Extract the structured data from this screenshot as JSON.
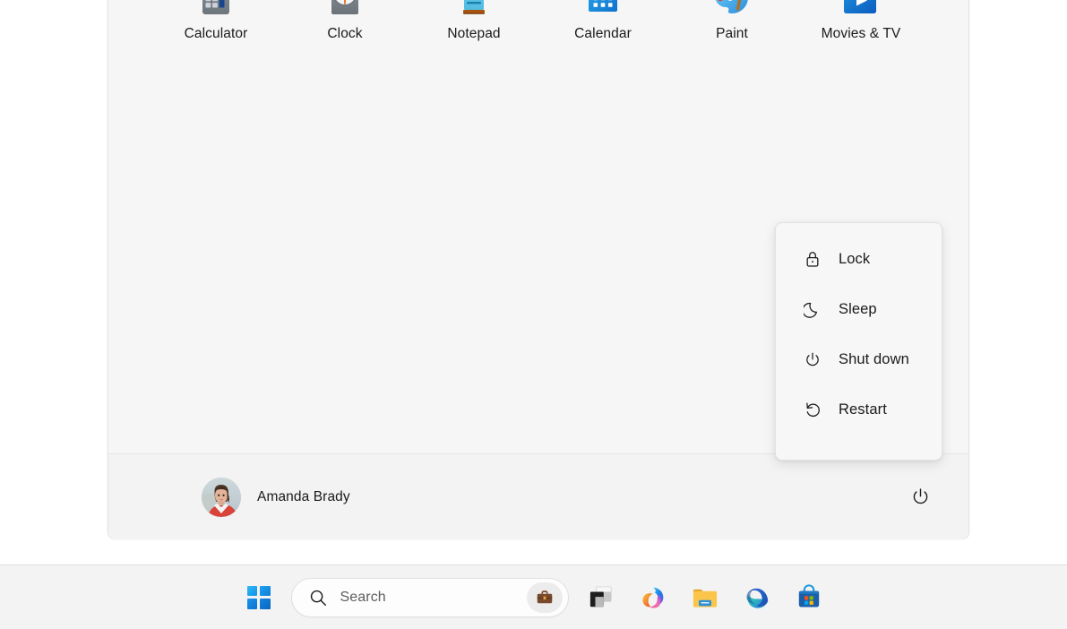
{
  "desktop": {
    "background_color": "#ffffff"
  },
  "start_menu": {
    "background_color": "#f6f6f6",
    "pinned_apps": [
      {
        "label": "Calculator",
        "icon": "calculator-icon"
      },
      {
        "label": "Clock",
        "icon": "clock-icon"
      },
      {
        "label": "Notepad",
        "icon": "notepad-icon"
      },
      {
        "label": "Calendar",
        "icon": "calendar-icon"
      },
      {
        "label": "Paint",
        "icon": "paint-icon"
      },
      {
        "label": "Movies & TV",
        "icon": "movies-tv-icon"
      }
    ],
    "footer": {
      "account_name": "Amanda Brady",
      "avatar_icon": "user-avatar-photo",
      "power_icon": "power-icon"
    }
  },
  "power_flyout": {
    "items": [
      {
        "label": "Lock",
        "icon": "lock-icon"
      },
      {
        "label": "Sleep",
        "icon": "moon-icon"
      },
      {
        "label": "Shut down",
        "icon": "power-icon"
      },
      {
        "label": "Restart",
        "icon": "restart-icon"
      }
    ]
  },
  "taskbar": {
    "background_color": "#f3f3f3",
    "start_button": {
      "name": "Start",
      "icon": "windows-logo-icon"
    },
    "search": {
      "placeholder": "Search",
      "search_icon": "search-icon",
      "briefcase_icon": "briefcase-icon"
    },
    "buttons": [
      {
        "name": "Task view",
        "icon": "task-view-icon"
      },
      {
        "name": "Copilot",
        "icon": "copilot-icon"
      },
      {
        "name": "File Explorer",
        "icon": "file-explorer-icon"
      },
      {
        "name": "Microsoft Edge",
        "icon": "edge-icon"
      },
      {
        "name": "Microsoft Store",
        "icon": "microsoft-store-icon"
      }
    ]
  }
}
